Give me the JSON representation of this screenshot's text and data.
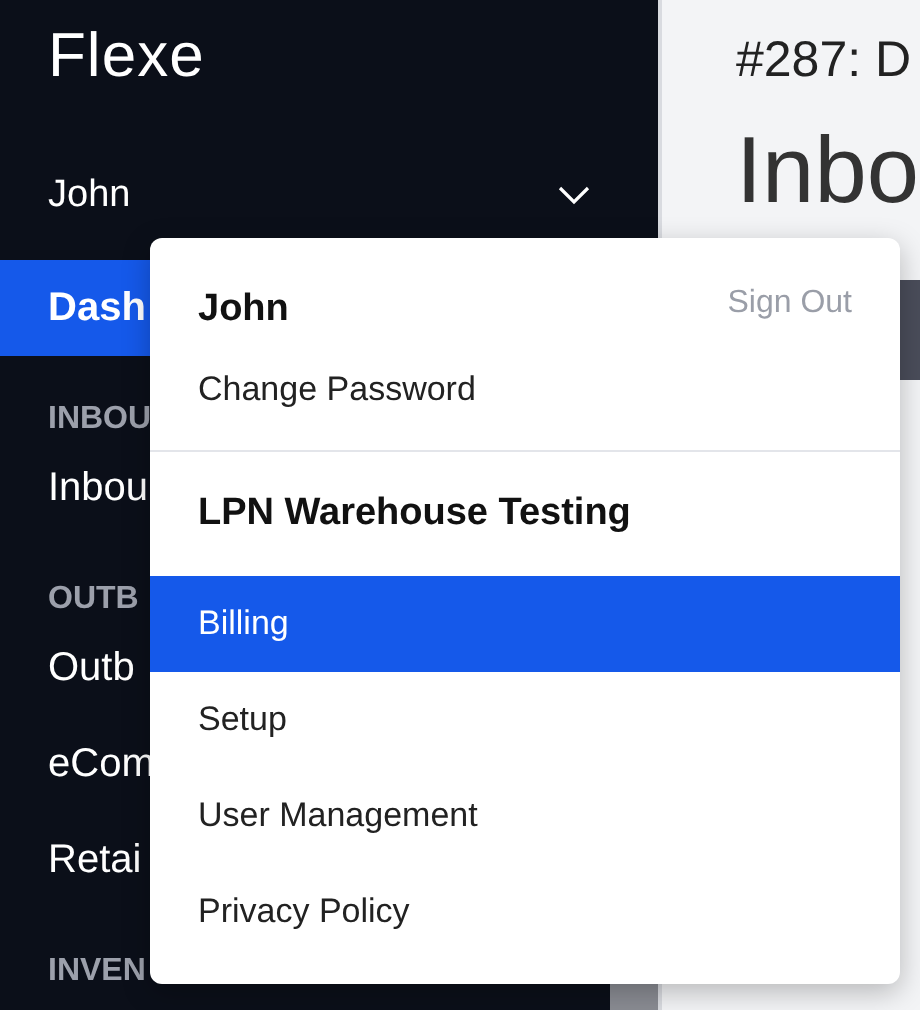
{
  "app": {
    "logo": "Flexe"
  },
  "sidebar": {
    "user": "John",
    "items": [
      {
        "kind": "item",
        "label": "Dash",
        "selected": true
      },
      {
        "kind": "section",
        "label": "INBOU"
      },
      {
        "kind": "item",
        "label": "Inbou",
        "selected": false
      },
      {
        "kind": "section",
        "label": "OUTB"
      },
      {
        "kind": "item",
        "label": "Outb",
        "selected": false
      },
      {
        "kind": "item",
        "label": "eCom",
        "selected": false
      },
      {
        "kind": "item",
        "label": "Retai",
        "selected": false
      },
      {
        "kind": "section",
        "label": "INVEN"
      }
    ]
  },
  "main": {
    "breadcrumb": "#287: D",
    "title": "Inbo"
  },
  "user_menu": {
    "name": "John",
    "sign_out": "Sign Out",
    "account_items": [
      {
        "label": "Change Password",
        "selected": false
      }
    ],
    "org_name": "LPN Warehouse Testing",
    "org_items": [
      {
        "label": "Billing",
        "selected": true
      },
      {
        "label": "Setup",
        "selected": false
      },
      {
        "label": "User Management",
        "selected": false
      },
      {
        "label": "Privacy Policy",
        "selected": false
      }
    ]
  }
}
